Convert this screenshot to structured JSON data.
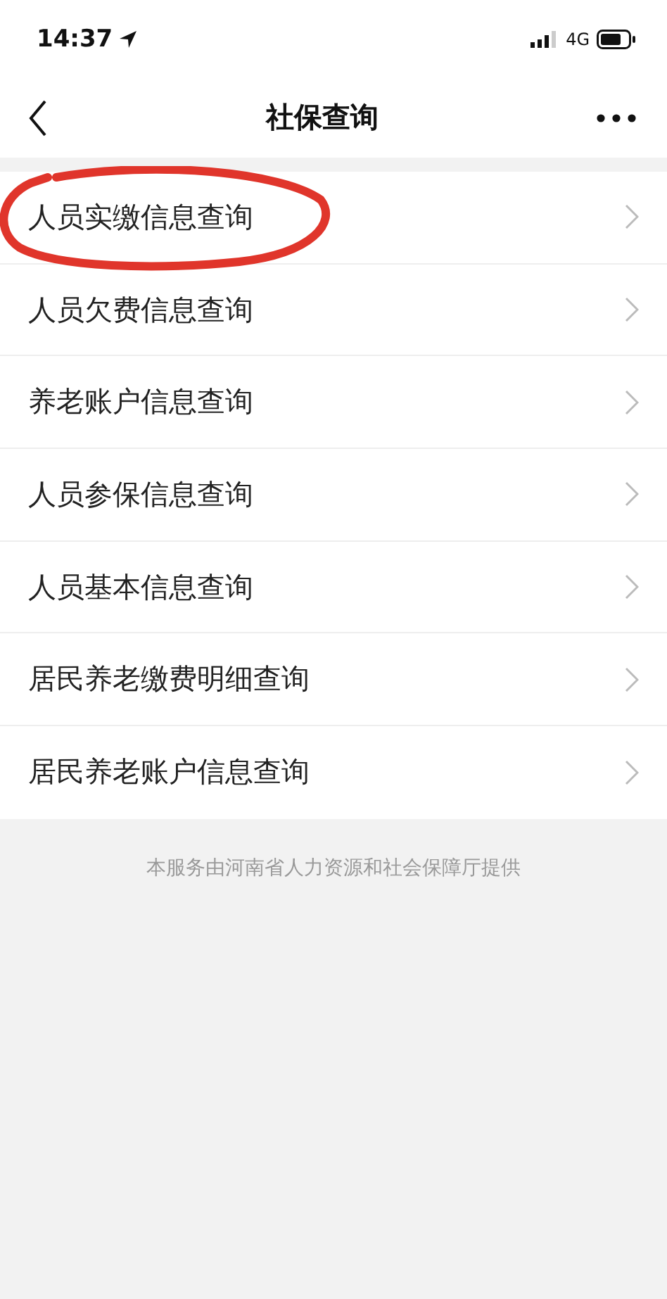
{
  "status_bar": {
    "time": "14:37",
    "network": "4G"
  },
  "nav_bar": {
    "title": "社保查询"
  },
  "items": [
    {
      "label": "人员实缴信息查询",
      "circled": true
    },
    {
      "label": "人员欠费信息查询",
      "circled": false
    },
    {
      "label": "养老账户信息查询",
      "circled": false
    },
    {
      "label": "人员参保信息查询",
      "circled": false
    },
    {
      "label": "人员基本信息查询",
      "circled": false
    },
    {
      "label": "居民养老缴费明细查询",
      "circled": false
    },
    {
      "label": "居民养老账户信息查询",
      "circled": false
    }
  ],
  "footer": "本服务由河南省人力资源和社会保障厅提供"
}
